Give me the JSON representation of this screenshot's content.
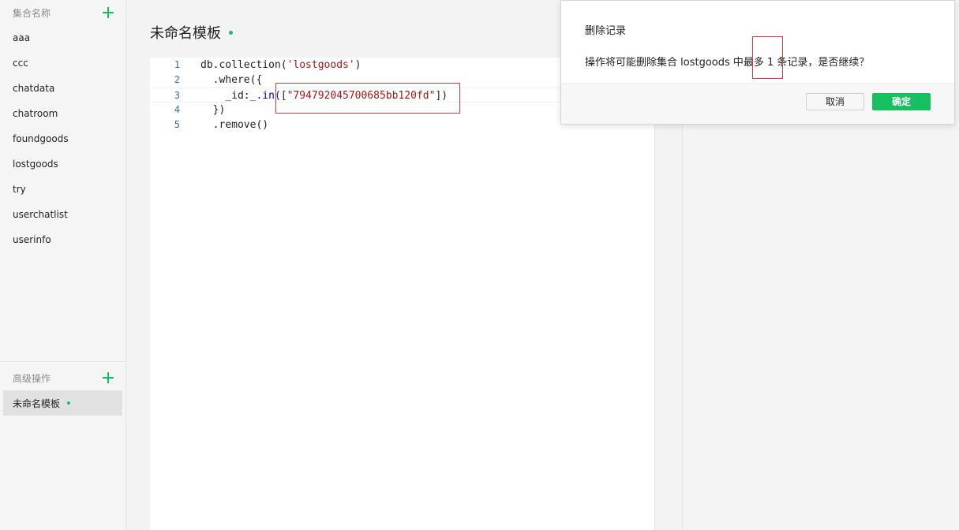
{
  "sidebar": {
    "collections_header": "集合名称",
    "collections": [
      "aaa",
      "ccc",
      "chatdata",
      "chatroom",
      "foundgoods",
      "lostgoods",
      "try",
      "userchatlist",
      "userinfo"
    ],
    "advanced_header": "高级操作",
    "template_name": "未命名模板"
  },
  "main": {
    "title": "未命名模板"
  },
  "editor": {
    "lines": [
      {
        "num": "1",
        "parts": [
          [
            "db.collection(",
            ""
          ],
          [
            "'lostgoods'",
            "str"
          ],
          [
            ")",
            ""
          ]
        ]
      },
      {
        "num": "2",
        "parts": [
          [
            "  .where({",
            ""
          ]
        ]
      },
      {
        "num": "3",
        "parts": [
          [
            "    _id:_.",
            ""
          ],
          [
            "in",
            "kw"
          ],
          [
            "([",
            ""
          ],
          [
            "\"794792045700685bb120fd\"",
            "str"
          ],
          [
            "])",
            ""
          ]
        ]
      },
      {
        "num": "4",
        "parts": [
          [
            "  })",
            ""
          ]
        ]
      },
      {
        "num": "5",
        "parts": [
          [
            "  .remove()",
            ""
          ]
        ]
      }
    ]
  },
  "dialog": {
    "title": "删除记录",
    "message": "操作将可能删除集合 lostgoods 中最多 1 条记录，是否继续？",
    "cancel_label": "取消",
    "ok_label": "确定"
  },
  "colors": {
    "accent": "#16c060",
    "annotation": "#d93a3a"
  }
}
